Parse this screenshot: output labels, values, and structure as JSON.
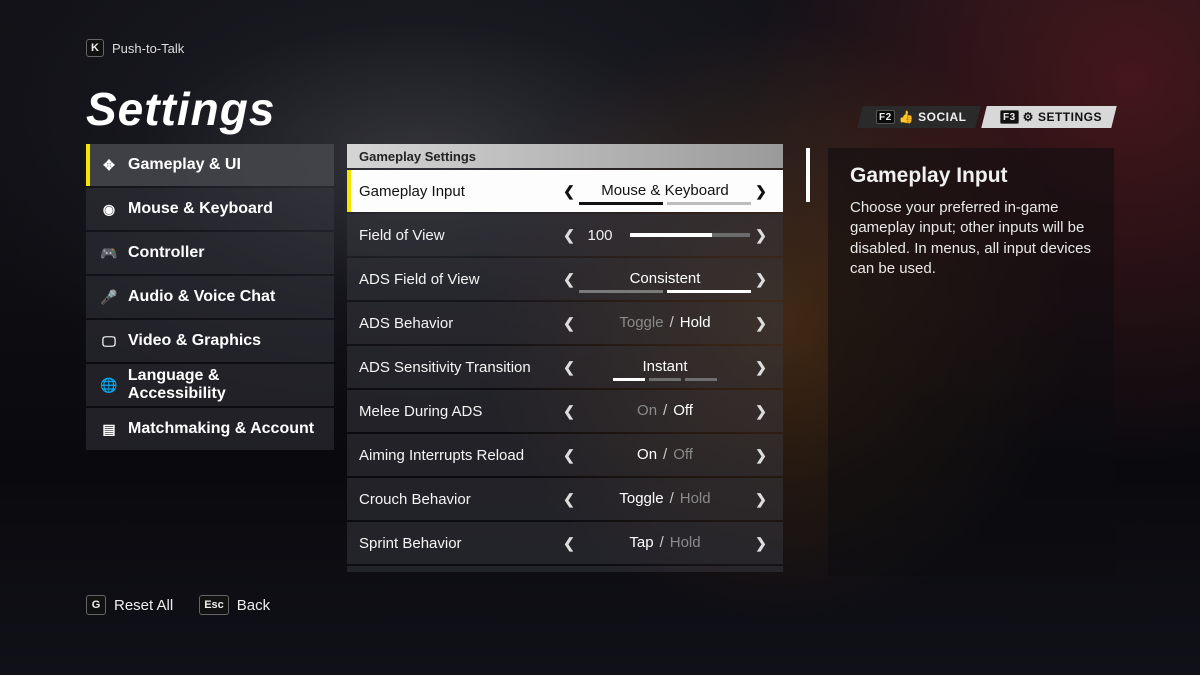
{
  "ptt": {
    "key": "K",
    "label": "Push-to-Talk"
  },
  "top_tabs": {
    "social": {
      "key": "F2",
      "label": "SOCIAL"
    },
    "settings": {
      "key": "F3",
      "label": "SETTINGS"
    }
  },
  "title": "Settings",
  "sidebar": {
    "items": [
      {
        "icon": "✥",
        "label": "Gameplay & UI",
        "active": true
      },
      {
        "icon": "◉",
        "label": "Mouse & Keyboard"
      },
      {
        "icon": "🎮",
        "label": "Controller"
      },
      {
        "icon": "🎤",
        "label": "Audio & Voice Chat"
      },
      {
        "icon": "🖵",
        "label": "Video & Graphics"
      },
      {
        "icon": "🌐",
        "label": "Language & Accessibility"
      },
      {
        "icon": "▤",
        "label": "Matchmaking & Account"
      }
    ]
  },
  "section_header": "Gameplay Settings",
  "rows": {
    "gameplay_input": {
      "label": "Gameplay Input",
      "value": "Mouse & Keyboard"
    },
    "fov": {
      "label": "Field of View",
      "value": "100",
      "percent": 68
    },
    "ads_fov": {
      "label": "ADS Field of View",
      "value": "Consistent"
    },
    "ads_behavior": {
      "label": "ADS Behavior",
      "opt1": "Toggle",
      "opt2": "Hold",
      "selected": 2
    },
    "ads_sens": {
      "label": "ADS Sensitivity Transition",
      "value": "Instant"
    },
    "melee_ads": {
      "label": "Melee During ADS",
      "opt1": "On",
      "opt2": "Off",
      "selected": 2
    },
    "aim_reload": {
      "label": "Aiming Interrupts Reload",
      "opt1": "On",
      "opt2": "Off",
      "selected": 1
    },
    "crouch": {
      "label": "Crouch Behavior",
      "opt1": "Toggle",
      "opt2": "Hold",
      "selected": 1
    },
    "sprint": {
      "label": "Sprint Behavior",
      "opt1": "Tap",
      "opt2": "Hold",
      "selected": 1
    }
  },
  "info": {
    "title": "Gameplay Input",
    "body": "Choose your preferred in-game gameplay input; other inputs will be disabled. In menus, all input devices can be used."
  },
  "footer": {
    "reset": {
      "key": "G",
      "label": "Reset All"
    },
    "back": {
      "key": "Esc",
      "label": "Back"
    }
  }
}
